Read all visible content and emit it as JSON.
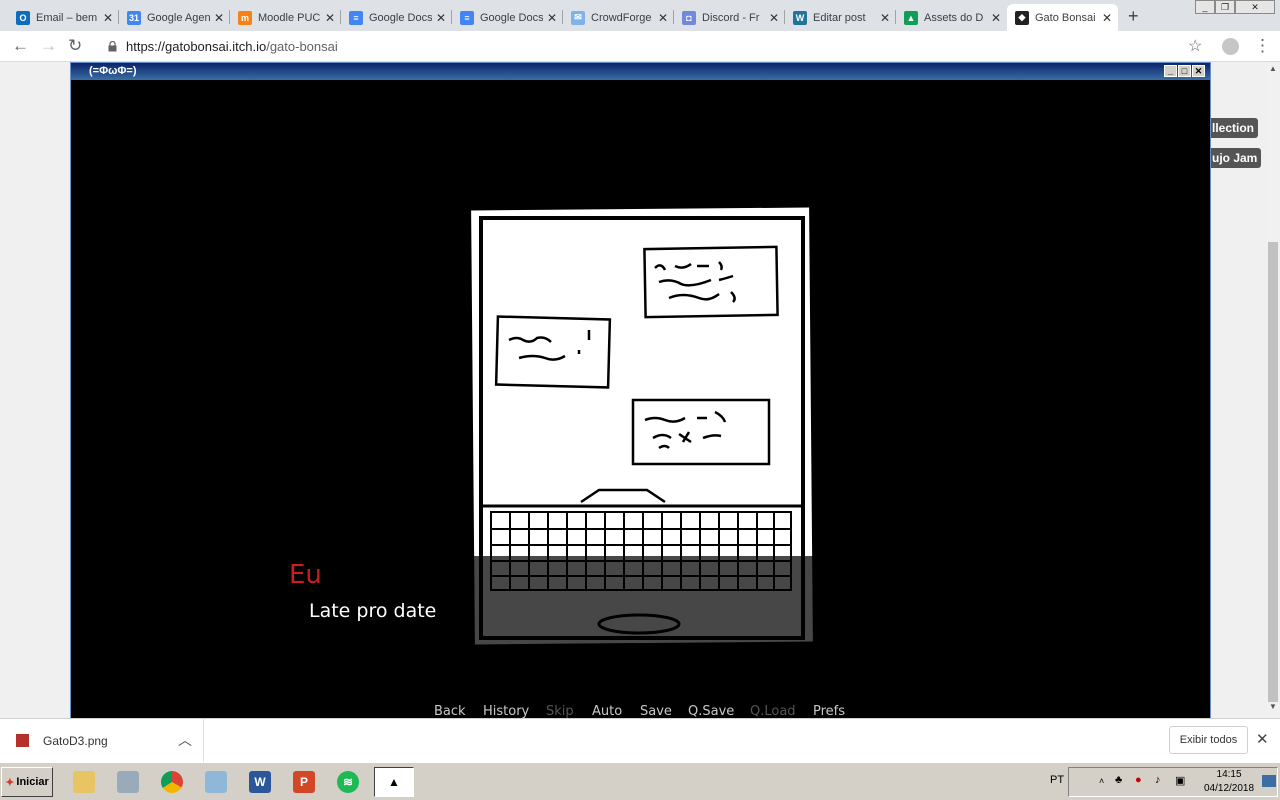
{
  "browser": {
    "tabs": [
      {
        "title": "Email – bem",
        "color": "#0f6cbd",
        "glyph": "O"
      },
      {
        "title": "Google Agen",
        "color": "#4285f4",
        "glyph": "31"
      },
      {
        "title": "Moodle PUC",
        "color": "#f98012",
        "glyph": "m"
      },
      {
        "title": "Google Docs",
        "color": "#4285f4",
        "glyph": "≡"
      },
      {
        "title": "Google Docs",
        "color": "#4285f4",
        "glyph": "≡"
      },
      {
        "title": "CrowdForge",
        "color": "#7fb3e8",
        "glyph": "✉"
      },
      {
        "title": "Discord - Fr",
        "color": "#7289da",
        "glyph": "◘"
      },
      {
        "title": "Editar post",
        "color": "#21759b",
        "glyph": "W"
      },
      {
        "title": "Assets do D",
        "color": "#0f9d58",
        "glyph": "▲"
      },
      {
        "title": "Gato Bonsai",
        "color": "#222222",
        "glyph": "◆"
      }
    ],
    "active_tab": 9,
    "url_host": "https://gatobonsai.itch.io",
    "url_path": "/gato-bonsai"
  },
  "side_tags": [
    "llection",
    "ujo Jam"
  ],
  "game": {
    "window_title": "(=ΦωΦ=)",
    "speaker": "Eu",
    "dialogue": "Late pro date",
    "quick_menu": [
      {
        "label": "Back",
        "enabled": true
      },
      {
        "label": "History",
        "enabled": true
      },
      {
        "label": "Skip",
        "enabled": false
      },
      {
        "label": "Auto",
        "enabled": true
      },
      {
        "label": "Save",
        "enabled": true
      },
      {
        "label": "Q.Save",
        "enabled": true
      },
      {
        "label": "Q.Load",
        "enabled": false
      },
      {
        "label": "Prefs",
        "enabled": true
      }
    ]
  },
  "downloads": {
    "file": "GatoD3.png",
    "show_all": "Exibir todos"
  },
  "taskbar": {
    "start": "Iniciar",
    "lang": "PT",
    "time": "14:15",
    "date": "04/12/2018"
  }
}
